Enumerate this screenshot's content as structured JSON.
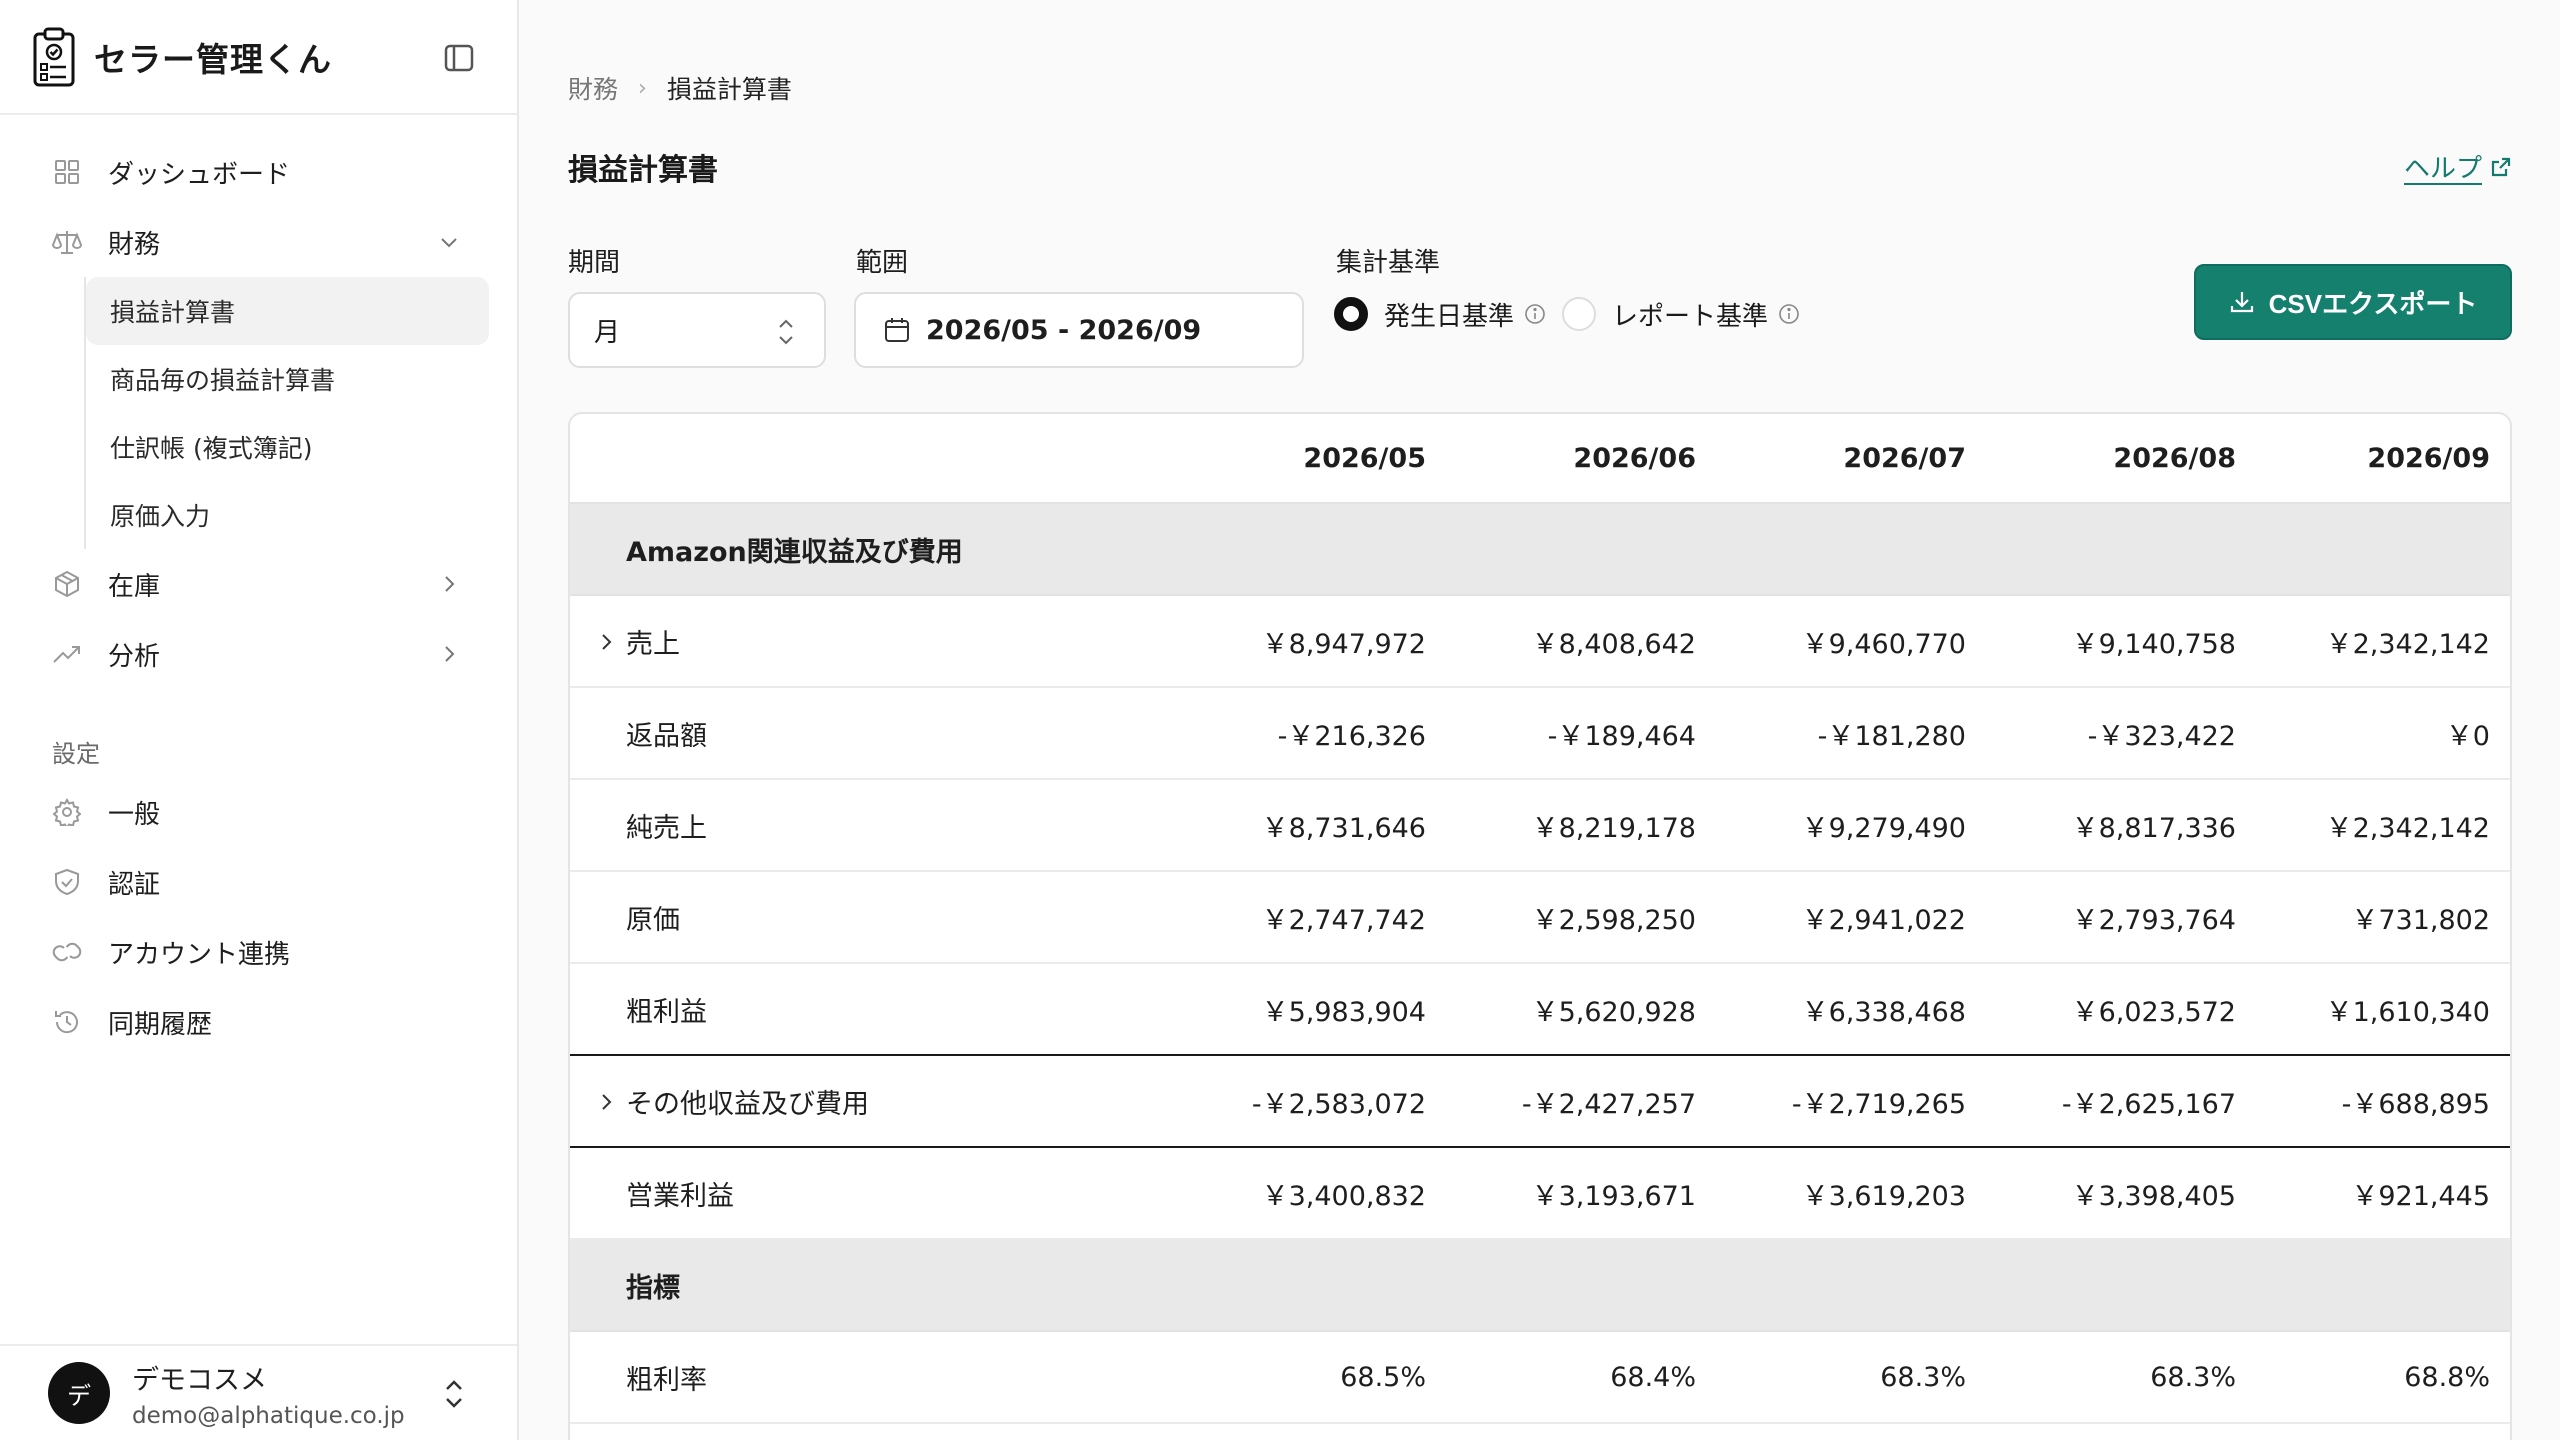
{
  "app": {
    "name": "セラー管理くん"
  },
  "nav": {
    "dashboard": "ダッシュボード",
    "finance": "財務",
    "finance_sub": [
      "損益計算書",
      "商品毎の損益計算書",
      "仕訳帳 (複式簿記)",
      "原価入力"
    ],
    "inventory": "在庫",
    "analysis": "分析",
    "settings_label": "設定",
    "settings": [
      "一般",
      "認証",
      "アカウント連携",
      "同期履歴"
    ]
  },
  "user": {
    "avatar": "デ",
    "name": "デモコスメ",
    "email": "demo@alphatique.co.jp"
  },
  "breadcrumb": {
    "parent": "財務",
    "current": "損益計算書"
  },
  "page": {
    "title": "損益計算書",
    "help": "ヘルプ"
  },
  "filters": {
    "period_label": "期間",
    "period_value": "月",
    "range_label": "範囲",
    "range_value": "2026/05 - 2026/09",
    "basis_label": "集計基準",
    "basis_options": [
      "発生日基準",
      "レポート基準"
    ]
  },
  "export_button": "CSVエクスポート",
  "table": {
    "columns": [
      "2026/05",
      "2026/06",
      "2026/07",
      "2026/08",
      "2026/09"
    ],
    "rows": [
      {
        "label": "Amazon関連収益及び費用",
        "group": true,
        "values": [
          "",
          "",
          "",
          "",
          ""
        ]
      },
      {
        "label": "売上",
        "expand": true,
        "values": [
          "￥8,947,972",
          "￥8,408,642",
          "￥9,460,770",
          "￥9,140,758",
          "￥2,342,142"
        ]
      },
      {
        "label": "返品額",
        "values": [
          "-￥216,326",
          "-￥189,464",
          "-￥181,280",
          "-￥323,422",
          "￥0"
        ]
      },
      {
        "label": "純売上",
        "values": [
          "￥8,731,646",
          "￥8,219,178",
          "￥9,279,490",
          "￥8,817,336",
          "￥2,342,142"
        ]
      },
      {
        "label": "原価",
        "values": [
          "￥2,747,742",
          "￥2,598,250",
          "￥2,941,022",
          "￥2,793,764",
          "￥731,802"
        ]
      },
      {
        "label": "粗利益",
        "values": [
          "￥5,983,904",
          "￥5,620,928",
          "￥6,338,468",
          "￥6,023,572",
          "￥1,610,340"
        ]
      },
      {
        "label": "その他収益及び費用",
        "expand": true,
        "values": [
          "-￥2,583,072",
          "-￥2,427,257",
          "-￥2,719,265",
          "-￥2,625,167",
          "-￥688,895"
        ]
      },
      {
        "label": "営業利益",
        "values": [
          "￥3,400,832",
          "￥3,193,671",
          "￥3,619,203",
          "￥3,398,405",
          "￥921,445"
        ]
      },
      {
        "label": "指標",
        "group": true,
        "values": [
          "",
          "",
          "",
          "",
          ""
        ]
      },
      {
        "label": "粗利率",
        "values": [
          "68.5%",
          "68.4%",
          "68.3%",
          "68.3%",
          "68.8%"
        ]
      }
    ]
  },
  "colors": {
    "accent": "#16806f",
    "group_bg": "#e9e9e9"
  }
}
